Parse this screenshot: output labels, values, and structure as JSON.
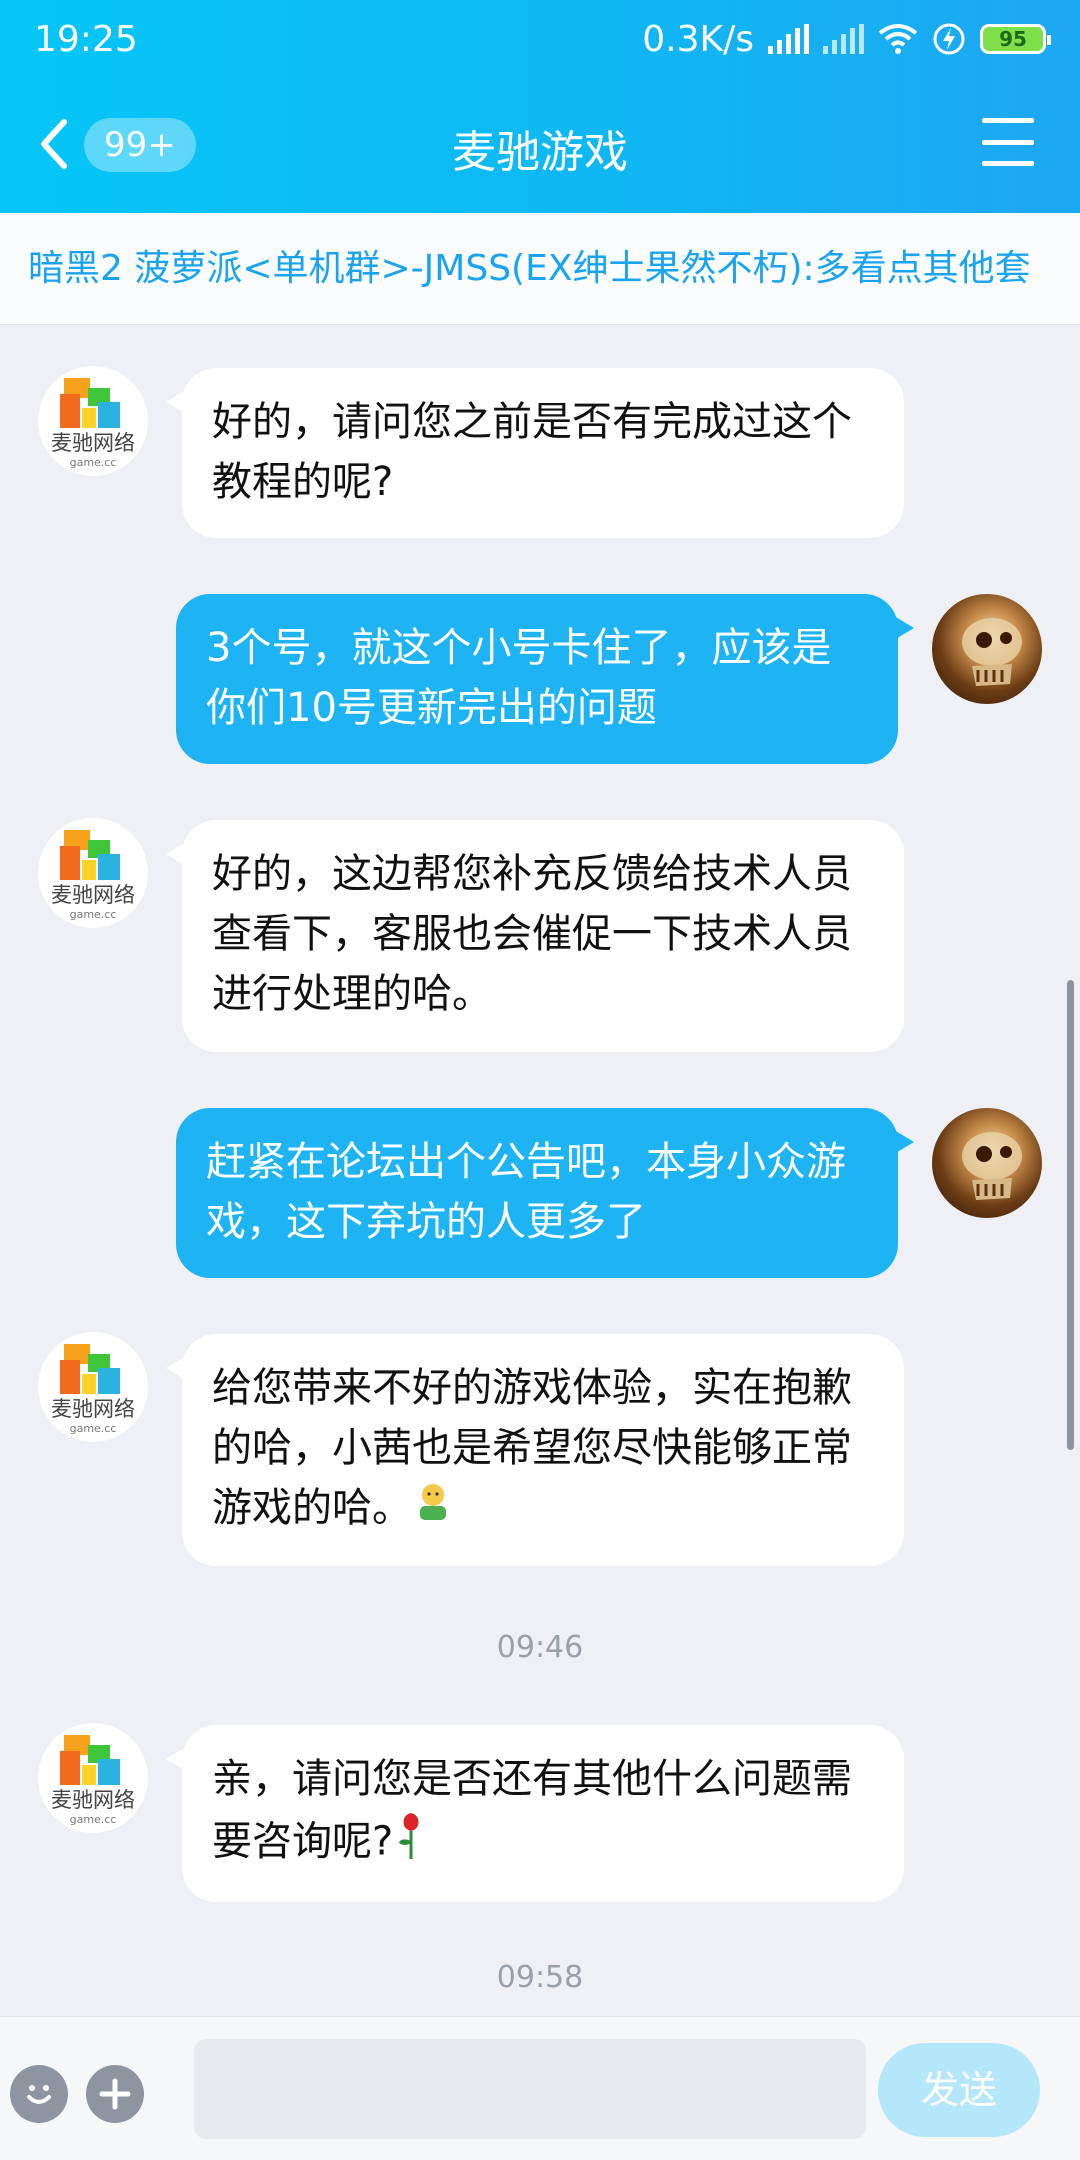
{
  "status_bar": {
    "time": "19:25",
    "net_speed": "0.3K/s",
    "battery": "95"
  },
  "nav": {
    "unread_badge": "99+",
    "title": "麦驰游戏"
  },
  "notice": {
    "text": "暗黑2 菠萝派<单机群>-JMSS(EX绅士果然不朽):多看点其他套"
  },
  "bot_avatar_label": "麦驰网络",
  "messages": [
    {
      "side": "left",
      "text": "好的，请问您之前是否有完成过这个教程的呢?"
    },
    {
      "side": "right",
      "text": "3个号，就这个小号卡住了，应该是你们10号更新完出的问题"
    },
    {
      "side": "left",
      "text": "好的，这边帮您补充反馈给技术人员查看下，客服也会催促一下技术人员进行处理的哈。"
    },
    {
      "side": "right",
      "text": "赶紧在论坛出个公告吧，本身小众游戏，这下弃坑的人更多了"
    },
    {
      "side": "left",
      "text": "给您带来不好的游戏体验，实在抱歉的哈，小茜也是希望您尽快能够正常游戏的哈。"
    },
    {
      "side": "time",
      "text": "09:46"
    },
    {
      "side": "left",
      "text": "亲，请问您是否还有其他什么问题需要咨询呢?"
    },
    {
      "side": "time",
      "text": "09:58"
    }
  ],
  "input": {
    "value": "",
    "send_label": "发送"
  },
  "icons": {
    "back": "chevron-left-icon",
    "menu": "hamburger-menu-icon",
    "emoji": "smiley-icon",
    "plus": "plus-icon"
  }
}
